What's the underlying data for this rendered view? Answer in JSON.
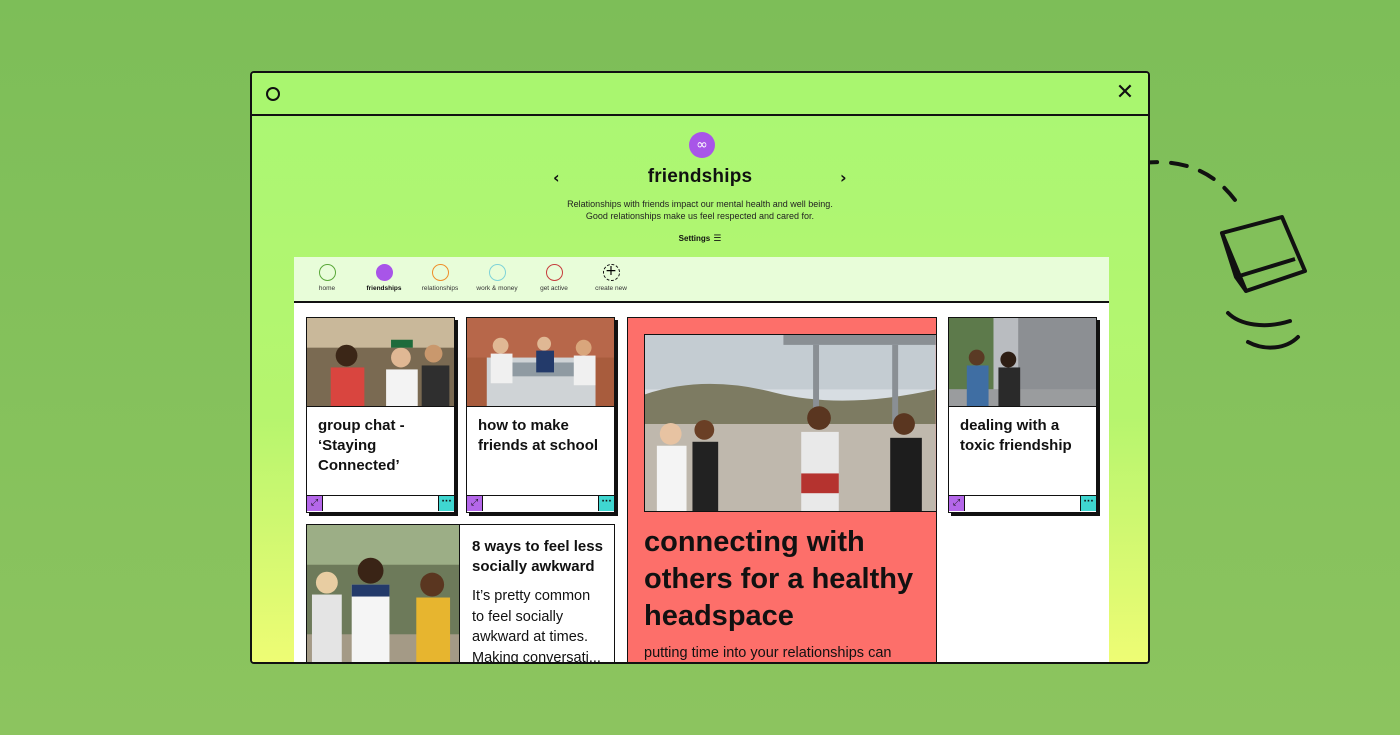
{
  "window": {
    "close_glyph": "✕"
  },
  "header": {
    "logo_glyph": "∞",
    "prev_glyph": "‹",
    "next_glyph": "›",
    "title": "friendships",
    "desc_line1": "Relationships with friends impact our mental health and well being.",
    "desc_line2": "Good relationships make us feel respected and cared for.",
    "settings_label": "Settings",
    "settings_icon": "☰"
  },
  "tabs": [
    {
      "label": "home",
      "color": "#5aa83a",
      "active": false
    },
    {
      "label": "friendships",
      "color": "#a855e8",
      "active": true
    },
    {
      "label": "relationships",
      "color": "#ef8f2a",
      "active": false
    },
    {
      "label": "work & money",
      "color": "#7fd3d8",
      "active": false
    },
    {
      "label": "get active",
      "color": "#c63d3d",
      "active": false
    },
    {
      "label": "create new",
      "color": "#111111",
      "active": false
    }
  ],
  "cards": [
    {
      "title_line1": "group chat -",
      "title_line2": "‘Staying",
      "title_line3": "Connected’"
    },
    {
      "title_line1": "how to make",
      "title_line2": "friends at school"
    },
    {
      "title_line1": "dealing with a",
      "title_line2": "toxic friendship"
    }
  ],
  "card_buttons": {
    "expand_glyph": "⤢",
    "more_glyph": "···"
  },
  "feature": {
    "title_line1": "connecting with",
    "title_line2": "others for a healthy",
    "title_line3": "headspace",
    "subtitle": "putting time into your relationships can"
  },
  "wide_card": {
    "title_line1": "8 ways to feel less",
    "title_line2": "socially awkward",
    "body_line1": "It’s pretty common",
    "body_line2": "to feel socially",
    "body_line3": "awkward at times.",
    "body_line4": "Making conversati..."
  },
  "colors": {
    "accent_purple": "#a855e8",
    "accent_cyan": "#3fd6d0",
    "feature_red": "#fd6f6a",
    "lime": "#abf773"
  }
}
